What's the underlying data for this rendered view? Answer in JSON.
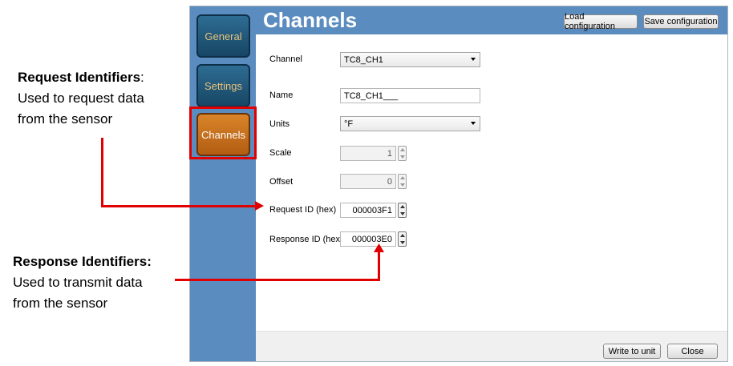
{
  "annotations": {
    "request": {
      "heading": "Request Identifiers",
      "heading_suffix": ":",
      "line1": "Used to request data",
      "line2": "from the sensor"
    },
    "response": {
      "heading": "Response Identifiers:",
      "line1": "Used to transmit data",
      "line2": "from the sensor"
    },
    "highlight_color": "#e00000"
  },
  "sidebar": {
    "items": [
      {
        "label": "General"
      },
      {
        "label": "Settings"
      },
      {
        "label": "Channels"
      }
    ]
  },
  "header": {
    "title": "Channels",
    "load_label": "Load configuration",
    "save_label": "Save configuration"
  },
  "form": {
    "channel": {
      "label": "Channel",
      "value": "TC8_CH1"
    },
    "name": {
      "label": "Name",
      "value": "TC8_CH1___"
    },
    "units": {
      "label": "Units",
      "value": "°F"
    },
    "scale": {
      "label": "Scale",
      "value": "1"
    },
    "offset": {
      "label": "Offset",
      "value": "0"
    },
    "request_id": {
      "label": "Request ID (hex)",
      "value": "000003F1"
    },
    "response_id": {
      "label": "Response ID (hex)",
      "value": "000003E0"
    }
  },
  "footer": {
    "write_label": "Write to unit",
    "close_label": "Close"
  },
  "colors": {
    "sidebar_bg": "#5b8cbf",
    "active_tab": "#c96f1c",
    "inactive_tab": "#1f5578"
  }
}
